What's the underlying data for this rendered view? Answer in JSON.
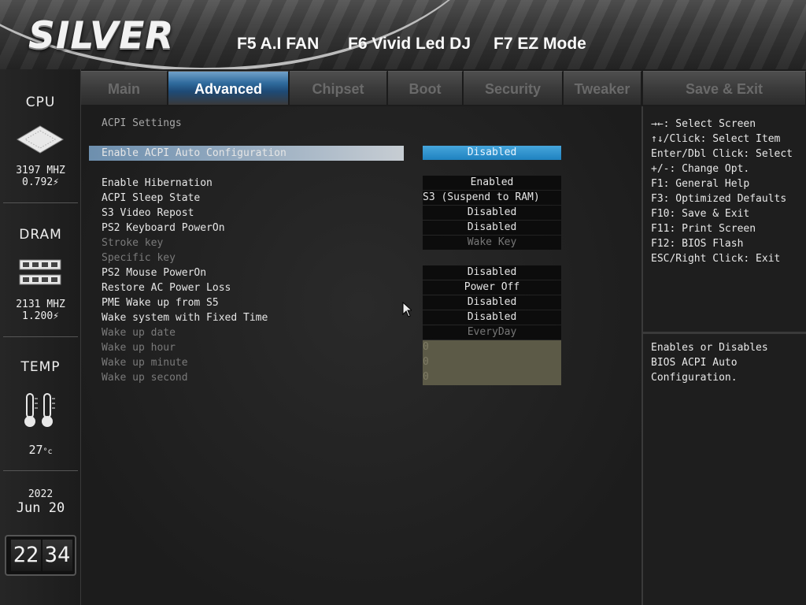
{
  "header": {
    "logo": "SILVER",
    "hotkeys": [
      "F5 A.I FAN",
      "F6 Vivid Led DJ",
      "F7 EZ Mode"
    ]
  },
  "sidebar": {
    "cpu": {
      "title": "CPU",
      "freq": "3197 MHZ",
      "volt": "0.792"
    },
    "dram": {
      "title": "DRAM",
      "freq": "2131 MHZ",
      "volt": "1.200"
    },
    "temp": {
      "title": "TEMP",
      "value": "27"
    },
    "date": {
      "year": "2022",
      "month": "Jun",
      "day": "20"
    },
    "time": {
      "hour": "22",
      "minute": "34"
    }
  },
  "tabs": [
    {
      "label": "Main",
      "active": false
    },
    {
      "label": "Advanced",
      "active": true
    },
    {
      "label": "Chipset",
      "active": false
    },
    {
      "label": "Boot",
      "active": false
    },
    {
      "label": "Security",
      "active": false
    },
    {
      "label": "Tweaker",
      "active": false
    },
    {
      "label": "Save & Exit",
      "active": false
    }
  ],
  "main": {
    "title": "ACPI Settings",
    "rows": [
      {
        "label": "Enable ACPI Auto Configuration",
        "value": "Disabled"
      },
      {
        "label": "Enable Hibernation",
        "value": "Enabled"
      },
      {
        "label": "ACPI Sleep State",
        "value": "S3 (Suspend to RAM)"
      },
      {
        "label": "S3 Video Repost",
        "value": "Disabled"
      },
      {
        "label": "PS2 Keyboard PowerOn",
        "value": "Disabled"
      },
      {
        "label": "Stroke key",
        "value": "Wake Key"
      },
      {
        "label": "Specific key",
        "value": ""
      },
      {
        "label": "PS2 Mouse PowerOn",
        "value": "Disabled"
      },
      {
        "label": "Restore AC Power Loss",
        "value": "Power Off"
      },
      {
        "label": "PME Wake up from S5",
        "value": "Disabled"
      },
      {
        "label": "Wake system with Fixed Time",
        "value": "Disabled"
      },
      {
        "label": "Wake up date",
        "value": "EveryDay"
      },
      {
        "label": "Wake up hour",
        "value": "0"
      },
      {
        "label": "Wake up minute",
        "value": "0"
      },
      {
        "label": "Wake up second",
        "value": "0"
      }
    ]
  },
  "help": {
    "keys": [
      "→←: Select Screen",
      "↑↓/Click: Select Item",
      "Enter/Dbl Click: Select",
      "+/-: Change Opt.",
      "F1: General Help",
      "F3: Optimized Defaults",
      "F10: Save & Exit",
      "F11: Print Screen",
      "F12: BIOS Flash",
      "ESC/Right Click: Exit"
    ],
    "description": [
      "Enables or Disables",
      "BIOS ACPI Auto",
      "Configuration."
    ]
  },
  "colors": {
    "accent": "#1f82c0",
    "selected_label": "#8ea6bd",
    "disabled_field": "#5c5a47"
  }
}
